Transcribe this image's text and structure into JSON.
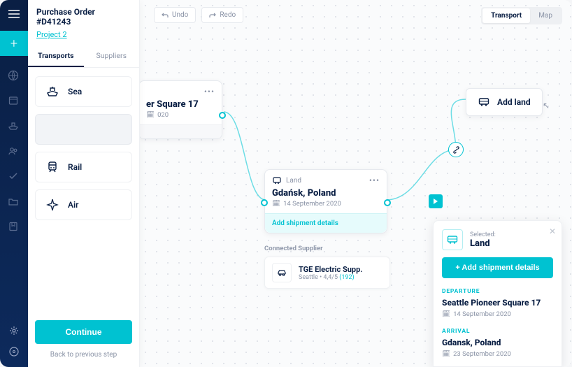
{
  "header": {
    "title": "Purchase Order #D41243",
    "project": "Project 2"
  },
  "tabs": {
    "transports": "Transports",
    "suppliers": "Suppliers"
  },
  "modes": {
    "sea": "Sea",
    "rail": "Rail",
    "air": "Air"
  },
  "panel_footer": {
    "continue": "Continue",
    "back": "Back to previous step"
  },
  "toolbar": {
    "undo": "Undo",
    "redo": "Redo"
  },
  "viewswitch": {
    "transport": "Transport",
    "map": "Map"
  },
  "nodes": {
    "seattle": {
      "title_fragment": "er Square 17",
      "date_fragment": "020"
    },
    "gdansk": {
      "type": "Land",
      "title": "Gdańsk, Poland",
      "date": "14 September 2020",
      "add_shipment": "Add shipment details"
    },
    "add_land": "Add land"
  },
  "supplier": {
    "section_label": "Connected Supplier",
    "name": "TGE Electric Supp.",
    "meta_city": "Seattle",
    "meta_rating": "4,4/5",
    "meta_count": "(192)"
  },
  "drawer": {
    "selected_label": "Selected:",
    "selected_value": "Land",
    "add_button": "+ Add shipment details",
    "departure_label": "DEPARTURE",
    "departure_title": "Seattle Pioneer Square 17",
    "departure_date": "14 September 2020",
    "arrival_label": "ARRIVAL",
    "arrival_title": "Gdansk, Poland",
    "arrival_date": "23 September 2020"
  }
}
